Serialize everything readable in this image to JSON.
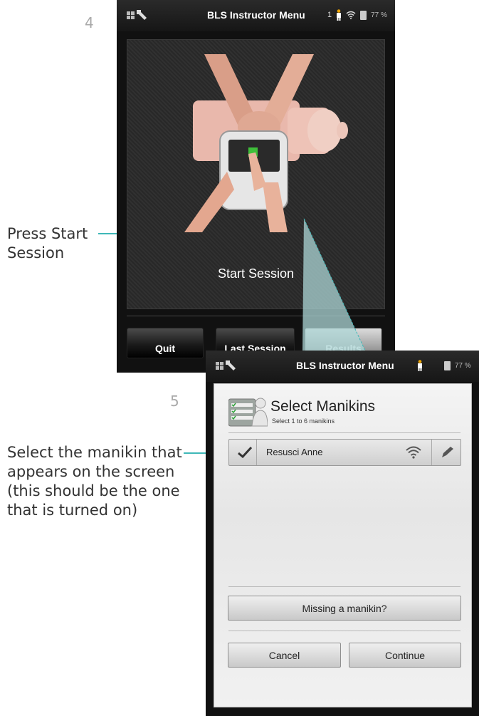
{
  "steps": {
    "step4": "4",
    "step5": "5"
  },
  "callouts": {
    "press_start": "Press Start\nSession",
    "select_manikin": "Select the manikin that\nappears on the screen\n(this should be the one\nthat is turned on)"
  },
  "screen1": {
    "title": "BLS Instructor Menu",
    "status": {
      "count": "1",
      "battery": "77 %"
    },
    "start_label": "Start Session",
    "buttons": {
      "quit": "Quit",
      "last_session": "Last Session",
      "results": "Results"
    }
  },
  "screen2": {
    "title": "BLS Instructor Menu",
    "status": {
      "battery": "77 %"
    },
    "header_title": "Select Manikins",
    "header_sub": "Select 1 to 6 manikins",
    "manikin_name": "Resusci Anne",
    "missing_label": "Missing a manikin?",
    "cancel_label": "Cancel",
    "continue_label": "Continue"
  },
  "colors": {
    "accent": "#3fb8b8",
    "selected_green": "#2ea33a"
  },
  "icons": [
    "wrench-icon",
    "person-icon",
    "wifi-icon",
    "battery-icon",
    "checkmark-icon",
    "edit-icon",
    "checklist-icon"
  ]
}
